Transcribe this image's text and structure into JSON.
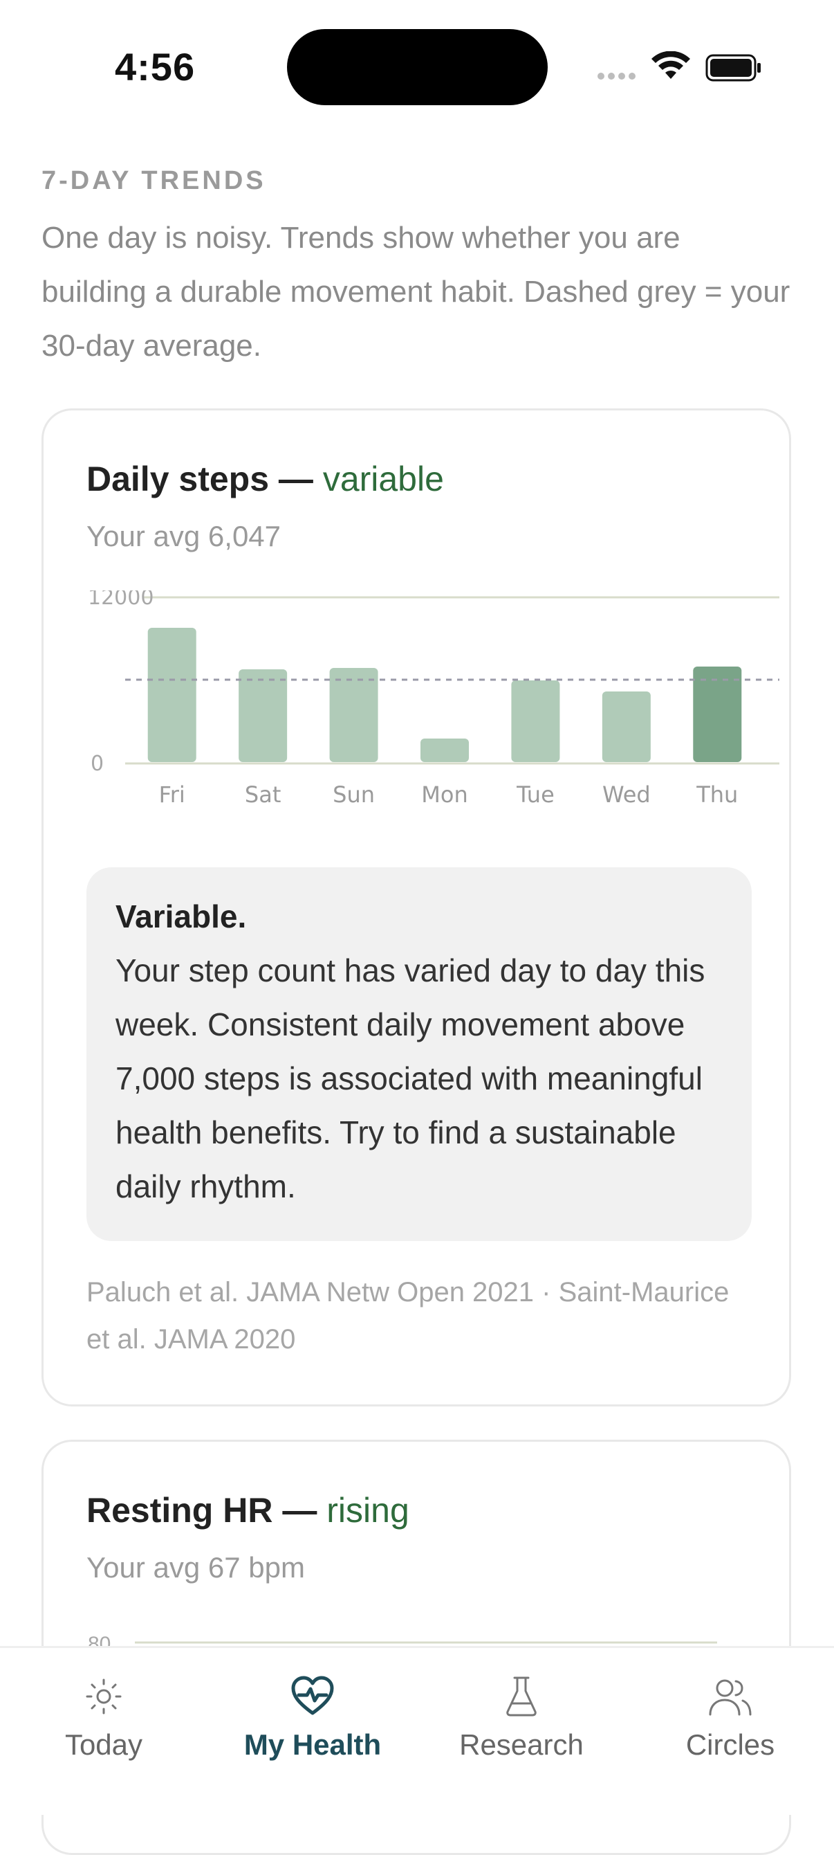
{
  "status_bar": {
    "time": "4:56"
  },
  "trends": {
    "label": "7-DAY TRENDS",
    "description": "One day is noisy. Trends show whether you are building a durable movement habit. Dashed grey = your 30-day average."
  },
  "steps_card": {
    "title": "Daily steps —",
    "status": "variable",
    "subtitle": "Your avg 6,047",
    "chart_data": {
      "type": "bar",
      "categories": [
        "Fri",
        "Sat",
        "Sun",
        "Mon",
        "Tue",
        "Wed",
        "Thu"
      ],
      "values": [
        9800,
        6800,
        6900,
        1800,
        6000,
        5200,
        7000
      ],
      "average": 6047,
      "ylim": [
        0,
        12000
      ],
      "y_ticks": [
        "12000",
        "0"
      ],
      "highlight_index": 6,
      "colors": {
        "bar": "#b0cbb8",
        "highlight": "#7aa488",
        "average_line": "#9a9aa8",
        "grid": "#d8dccb"
      }
    },
    "insight_title": "Variable.",
    "insight_body": "Your step count has varied day to day this week. Consistent daily movement above 7,000 steps is associated with meaningful health benefits. Try to find a sustainable daily rhythm.",
    "citation": "Paluch et al. JAMA Netw Open 2021 · Saint-Maurice et al. JAMA 2020"
  },
  "hr_card": {
    "title": "Resting HR —",
    "status": "rising",
    "subtitle": "Your avg 67 bpm",
    "y_top_tick": "80"
  },
  "nav": {
    "items": [
      {
        "label": "Today",
        "icon": "sun-icon"
      },
      {
        "label": "My Health",
        "icon": "heart-pulse-icon"
      },
      {
        "label": "Research",
        "icon": "flask-icon"
      },
      {
        "label": "Circles",
        "icon": "users-icon"
      }
    ],
    "active_index": 1,
    "active_color": "#1f4d5a"
  }
}
